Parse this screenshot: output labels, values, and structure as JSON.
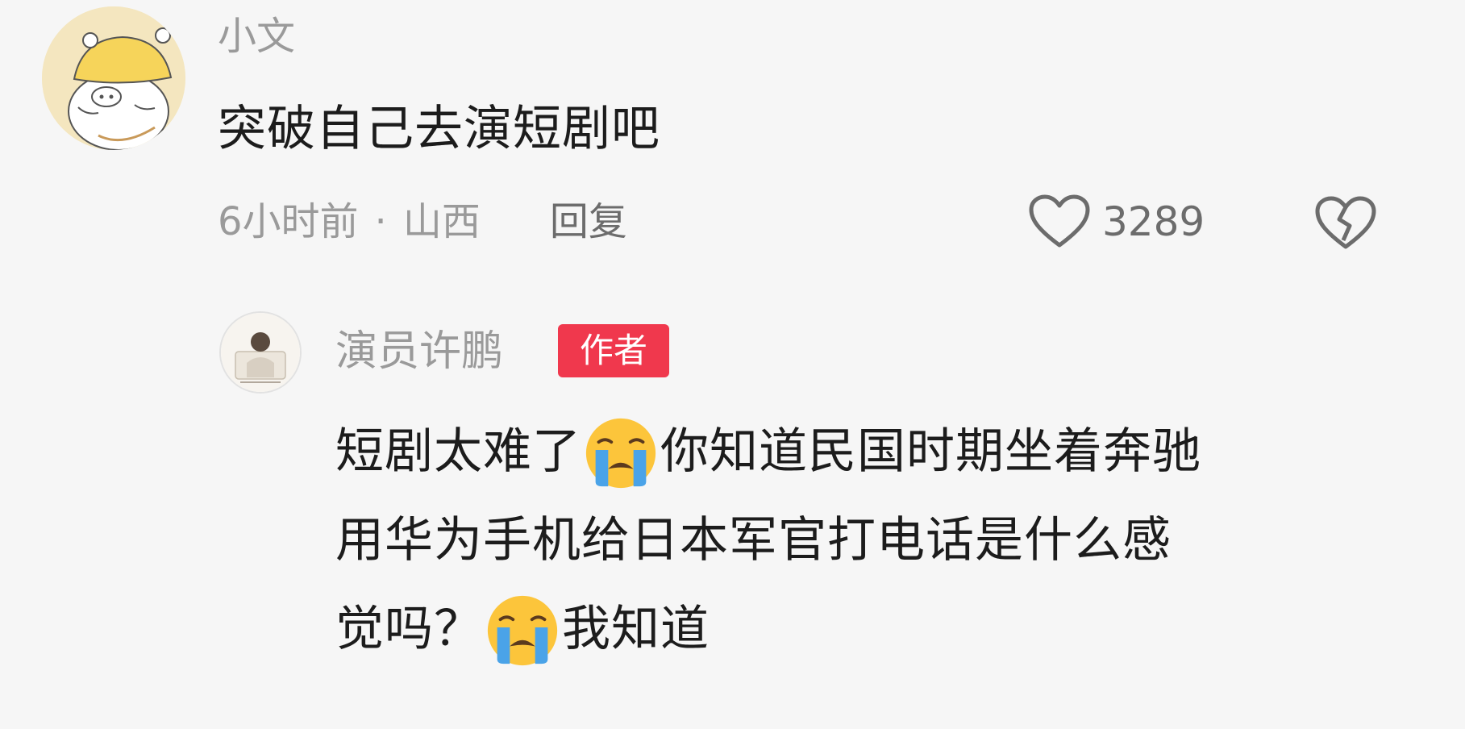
{
  "comment": {
    "username": "小文",
    "text": "突破自己去演短剧吧",
    "time": "6小时前",
    "location": "山西",
    "separator": "·",
    "reply_label": "回复",
    "like_count": "3289"
  },
  "reply": {
    "username": "演员许鹏",
    "badge": "作者",
    "text_part1": "短剧太难了",
    "text_part2": "你知道民国时期坐着奔驰",
    "text_line2": "用华为手机给日本军官打电话是什么感",
    "text_part3": "觉吗？",
    "text_part4": "我知道",
    "emoji": "crying-face-emoji"
  },
  "colors": {
    "background": "#f6f6f6",
    "text": "#1c1c1c",
    "meta": "#9a9a9a",
    "badge": "#f0384d"
  }
}
